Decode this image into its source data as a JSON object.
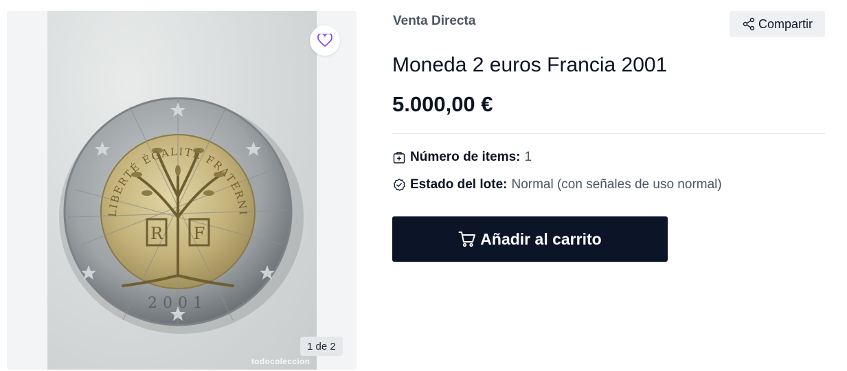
{
  "gallery": {
    "image_alt": "Moneda 2 euros Francia 2001",
    "watermark": "todocoleccion",
    "counter": "1 de 2",
    "favorite_icon": "heart-outline-icon",
    "coin_inscription_top": "LIBERTÉ ÉGALITÉ FRATERNITÉ",
    "coin_year": "2001"
  },
  "product": {
    "sale_type": "Venta Directa",
    "share_label": "Compartir",
    "share_icon": "share-icon",
    "title": "Moneda 2 euros Francia 2001",
    "price": "5.000,00 €",
    "items_label": "Número de items:",
    "items_value": "1",
    "items_icon": "box-plus-icon",
    "state_label": "Estado del lote:",
    "state_value": "Normal (con señales de uso normal)",
    "state_icon": "badge-check-icon",
    "cart_label": "Añadir al carrito",
    "cart_icon": "cart-icon"
  },
  "colors": {
    "primary_button": "#0b1527",
    "favorite_heart": "#7c3aed",
    "muted_text": "#4b5563"
  }
}
